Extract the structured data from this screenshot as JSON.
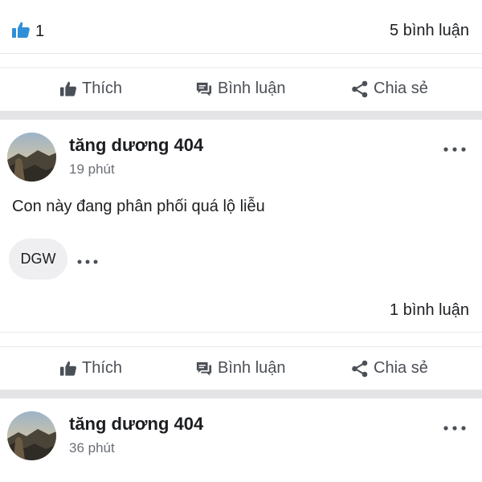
{
  "post1": {
    "like_count": "1",
    "comment_count": "5 bình luận"
  },
  "actions": {
    "like": "Thích",
    "comment": "Bình luận",
    "share": "Chia sẻ"
  },
  "post2": {
    "author": "tăng dương 404",
    "time": "19 phút",
    "text": "Con này đang phân phối quá lộ liễu",
    "tag": "DGW",
    "comment_count": "1 bình luận"
  },
  "post3": {
    "author": "tăng dương 404",
    "time": "36 phút"
  },
  "colors": {
    "like_blue": "#2f8fd6",
    "action_gray": "#4b4f56",
    "separator": "#e4e4e7"
  }
}
